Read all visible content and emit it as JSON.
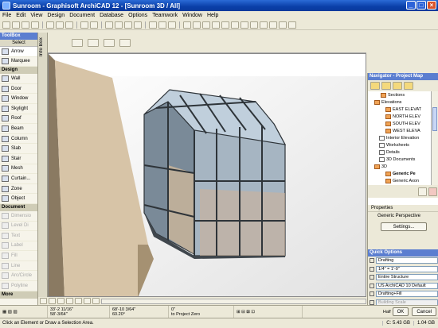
{
  "window": {
    "title": "Sunroom - Graphisoft ArchiCAD 12 - [Sunroom 3D / All]",
    "min": "_",
    "max": "□",
    "close": "×"
  },
  "menu": [
    "File",
    "Edit",
    "View",
    "Design",
    "Document",
    "Database",
    "Options",
    "Teamwork",
    "Window",
    "Help"
  ],
  "toolbox": {
    "title": "ToolBox",
    "select_label": "Select",
    "items_top": [
      {
        "label": "Arrow",
        "icon": "arrow-icon",
        "selected": true
      },
      {
        "label": "Marquee",
        "icon": "marquee-icon"
      }
    ],
    "design_label": "Design",
    "design_items": [
      {
        "label": "Wall",
        "icon": "wall-icon"
      },
      {
        "label": "Door",
        "icon": "door-icon"
      },
      {
        "label": "Window",
        "icon": "window-icon"
      },
      {
        "label": "Skylight",
        "icon": "skylight-icon"
      },
      {
        "label": "Roof",
        "icon": "roof-icon"
      },
      {
        "label": "Beam",
        "icon": "beam-icon"
      },
      {
        "label": "Column",
        "icon": "column-icon"
      },
      {
        "label": "Slab",
        "icon": "slab-icon"
      },
      {
        "label": "Stair",
        "icon": "stair-icon"
      },
      {
        "label": "Mesh",
        "icon": "mesh-icon"
      },
      {
        "label": "Curtain...",
        "icon": "curtain-wall-icon"
      },
      {
        "label": "Zone",
        "icon": "zone-icon"
      },
      {
        "label": "Object",
        "icon": "object-icon"
      }
    ],
    "document_label": "Document",
    "document_items": [
      {
        "label": "Dimensio",
        "icon": "dimension-icon"
      },
      {
        "label": "Level Di",
        "icon": "level-dimension-icon"
      },
      {
        "label": "Text",
        "icon": "text-icon"
      },
      {
        "label": "Label",
        "icon": "label-icon"
      },
      {
        "label": "Fill",
        "icon": "fill-icon"
      },
      {
        "label": "Line",
        "icon": "line-icon"
      },
      {
        "label": "Arc/Circle",
        "icon": "arc-icon"
      },
      {
        "label": "Polyline",
        "icon": "polyline-icon"
      }
    ],
    "more_label": "More"
  },
  "infobox": {
    "label": "Info Box"
  },
  "navigator": {
    "title": "Navigator - Project Map",
    "items": [
      {
        "label": "Sections",
        "indent": 2,
        "icon": "folder"
      },
      {
        "label": "Elevations",
        "indent": 1,
        "icon": "folder"
      },
      {
        "label": "EAST ELEVAT",
        "indent": 3,
        "icon": "elevation"
      },
      {
        "label": "NORTH ELEV",
        "indent": 3,
        "icon": "elevation"
      },
      {
        "label": "SOUTH ELEV",
        "indent": 3,
        "icon": "elevation"
      },
      {
        "label": "WEST ELEVA",
        "indent": 3,
        "icon": "elevation"
      },
      {
        "label": "Interior Elevation",
        "indent": 2,
        "icon": "doc"
      },
      {
        "label": "Worksheets",
        "indent": 2,
        "icon": "doc"
      },
      {
        "label": "Details",
        "indent": 2,
        "icon": "doc"
      },
      {
        "label": "3D Documents",
        "indent": 2,
        "icon": "doc"
      },
      {
        "label": "3D",
        "indent": 1,
        "icon": "folder"
      },
      {
        "label": "Generic Pe",
        "indent": 3,
        "icon": "elevation",
        "selected": true
      },
      {
        "label": "Generic Axon",
        "indent": 3,
        "icon": "elevation"
      }
    ]
  },
  "properties": {
    "header": "Properties",
    "value": "Generic Perspective",
    "settings_button": "Settings..."
  },
  "quick_options": {
    "title": "Quick Options",
    "rows": [
      "Drafting",
      "1/4\"   =   1'-0\"",
      "Entire Structure",
      "US ArchiCAD 10 Default",
      "Drafting+Fill",
      "Building Scale"
    ]
  },
  "coords": {
    "dx": "33'-2 11/16\"",
    "dy": "58'-3/64\"",
    "a1": "68'-10 3/64\"",
    "a2": "60.20°",
    "z": "0\"",
    "to_zero": "to Project Zero",
    "ok": "OK",
    "cancel": "Cancel",
    "half": "Half"
  },
  "status": {
    "message": "Click an Element or Draw a Selection Area.",
    "disk": "C: 5.43 GB",
    "mem": "1.04 GB"
  }
}
